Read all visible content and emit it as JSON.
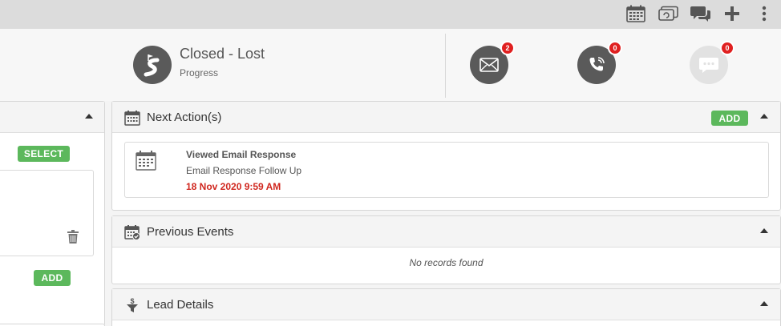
{
  "topbar": {
    "icons": [
      "calendar-icon",
      "devices-icon",
      "chat-icon",
      "plus-icon",
      "more-vertical-icon"
    ]
  },
  "status": {
    "title": "Closed - Lost",
    "subtitle": "Progress",
    "icon": "road-icon"
  },
  "comms": {
    "email": {
      "icon": "envelope-icon",
      "count": "2"
    },
    "phone": {
      "icon": "phone-icon",
      "count": "0"
    },
    "sms": {
      "icon": "message-icon",
      "count": "0"
    }
  },
  "left_panel": {
    "select_label": "SELECT",
    "add_label": "ADD"
  },
  "next_actions": {
    "title": "Next Action(s)",
    "add_label": "ADD",
    "items": [
      {
        "title": "Viewed Email Response",
        "subtitle": "Email Response Follow Up",
        "date": "18 Nov 2020 9:59 AM"
      }
    ]
  },
  "previous_events": {
    "title": "Previous Events",
    "empty_text": "No records found"
  },
  "lead_details": {
    "title": "Lead Details"
  },
  "colors": {
    "accent_green": "#5cb85c",
    "badge_red": "#e02020",
    "date_red": "#d0271f",
    "icon_dark": "#5a5a5a"
  }
}
